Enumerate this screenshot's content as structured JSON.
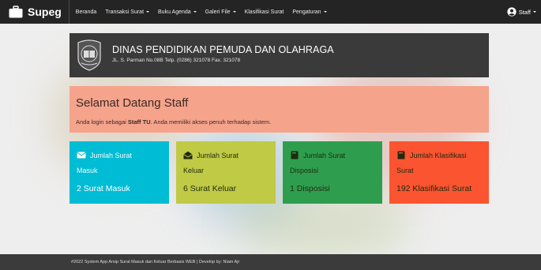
{
  "navbar": {
    "brand": "Supeg",
    "items": [
      {
        "label": "Beranda",
        "dropdown": false
      },
      {
        "label": "Transaksi Surat",
        "dropdown": true
      },
      {
        "label": "Buku Agenda",
        "dropdown": true
      },
      {
        "label": "Galeri File",
        "dropdown": true
      },
      {
        "label": "Klasifikasi Surat",
        "dropdown": false
      },
      {
        "label": "Pengaturan",
        "dropdown": true
      }
    ],
    "user": "Staff"
  },
  "header": {
    "org_name": "DINAS PENDIDIKAN PEMUDA DAN OLAHRAGA",
    "address": "JL. S. Parman No.08B Telp. (0286) 321078 Fax. 321078"
  },
  "welcome": {
    "title": "Selamat Datang Staff",
    "msg_prefix": "Anda login sebagai ",
    "role": "Staff TU",
    "msg_suffix": ". Anda memiliki akses penuh terhadap sistem."
  },
  "cards": [
    {
      "title": "Jumlah Surat",
      "sub": "Masuk",
      "count": "2 Surat Masuk",
      "color": "#00bcd4",
      "icon": "envelope-icon"
    },
    {
      "title": "Jumlah Surat",
      "sub": "Keluar",
      "count": "6 Surat Keluar",
      "color": "#c0ca45",
      "icon": "envelope-open-icon"
    },
    {
      "title": "Jumlah Surat",
      "sub": "Disposisi",
      "count": "1 Disposisi",
      "color": "#2e9e4e",
      "icon": "book-icon"
    },
    {
      "title": "Jumlah Klasifikasi",
      "sub": "Surat",
      "count": "192 Klasifikasi Surat",
      "color": "#fa5430",
      "icon": "book-icon"
    }
  ],
  "footer": {
    "text": "#2022 System App Arsip Surat Masuk dan Keluar Berbasis WEB | Develop by: Niam Ajr"
  },
  "colors": {
    "navbar": "#242424",
    "header": "#3a3a3a",
    "welcome": "#f6a38c",
    "footer": "#3b3b3b"
  }
}
